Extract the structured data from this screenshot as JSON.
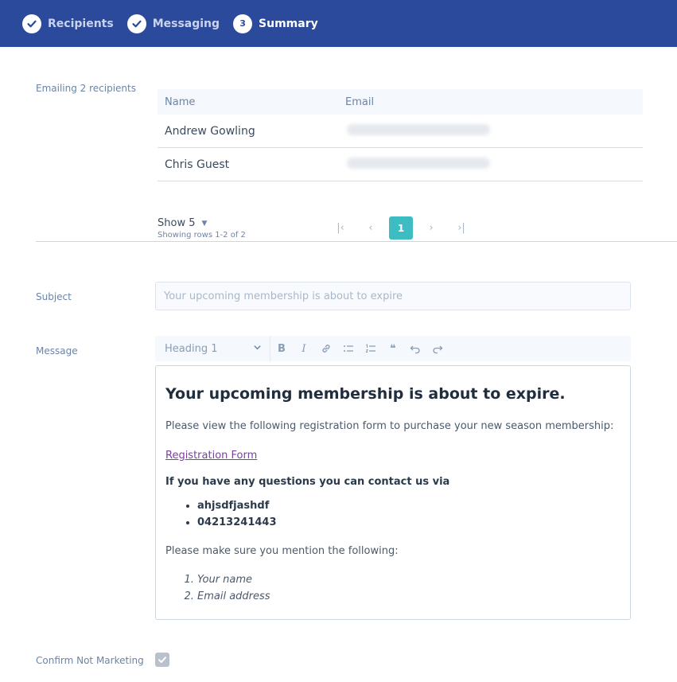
{
  "stepper": {
    "steps": [
      {
        "label": "Recipients",
        "state": "done"
      },
      {
        "label": "Messaging",
        "state": "done"
      },
      {
        "label": "Summary",
        "state": "active",
        "number": "3"
      }
    ]
  },
  "recipients": {
    "label": "Emailing 2 recipients",
    "columns": [
      "Name",
      "Email"
    ],
    "rows": [
      {
        "name": "Andrew Gowling",
        "email_hidden": true
      },
      {
        "name": "Chris Guest",
        "email_hidden": true
      }
    ],
    "show_label": "Show 5",
    "showing_rows": "Showing rows 1-2 of 2",
    "pagination": {
      "first": "first-page-icon",
      "prev": "prev-page-icon",
      "current": "1",
      "next": "next-page-icon",
      "last": "last-page-icon"
    }
  },
  "subject": {
    "label": "Subject",
    "placeholder": "Your upcoming membership is about to expire"
  },
  "message": {
    "label": "Message",
    "toolbar": {
      "heading": "Heading 1",
      "buttons": [
        "bold-icon",
        "italic-icon",
        "link-icon",
        "bullet-list-icon",
        "numbered-list-icon",
        "quote-icon",
        "undo-icon",
        "redo-icon"
      ]
    },
    "content": {
      "heading": "Your upcoming membership is about to expire.",
      "intro": "Please view the following registration form to purchase your new season membership:",
      "link": "Registration Form",
      "contact_heading": "If you have any questions you can contact us via",
      "contacts": [
        "ahjsdfjashdf",
        "04213241443"
      ],
      "mention": "Please make sure you mention the following:",
      "items": [
        "Your name",
        "Email address"
      ]
    }
  },
  "confirm": {
    "label": "Confirm Not Marketing",
    "checked": true
  },
  "colors": {
    "header": "#2b4a9b",
    "accent": "#3dbcc2",
    "link": "#7b3f9e"
  }
}
